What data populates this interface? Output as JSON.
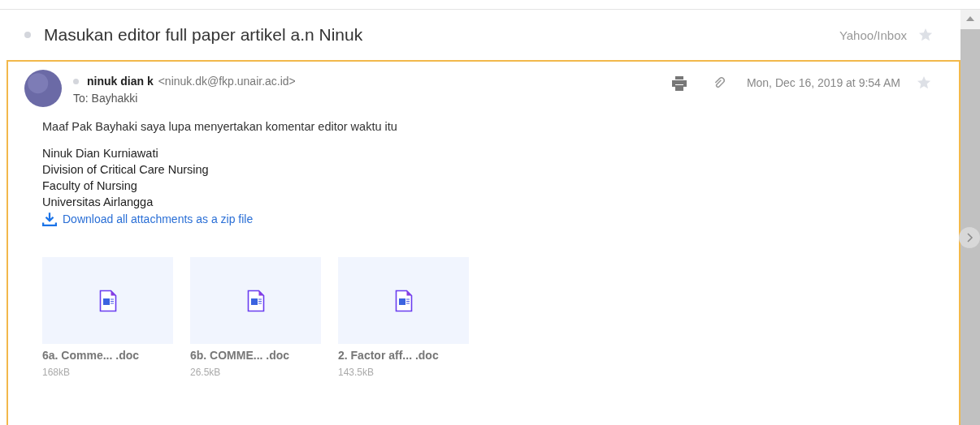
{
  "subject": {
    "title": "Masukan editor full paper artikel a.n Ninuk",
    "folder": "Yahoo/Inbox",
    "starred": false
  },
  "message": {
    "sender_name": "ninuk dian k",
    "sender_email": "<ninuk.dk@fkp.unair.ac.id>",
    "to": "To: Bayhakki",
    "date": "Mon, Dec 16, 2019 at 9:54 AM",
    "starred": false,
    "body": [
      "Maaf Pak Bayhaki saya lupa menyertakan komentar editor waktu itu"
    ],
    "signature": [
      "Ninuk Dian Kurniawati",
      "Division of Critical Care Nursing",
      "Faculty of Nursing",
      "Universitas Airlangga"
    ],
    "download_link": "Download all attachments as a zip file",
    "attachments": [
      {
        "name": "6a. Comme...  .doc",
        "size": "168kB"
      },
      {
        "name": "6b. COMME... .doc",
        "size": "26.5kB"
      },
      {
        "name": "2. Factor aff... .doc",
        "size": "143.5kB"
      }
    ]
  }
}
